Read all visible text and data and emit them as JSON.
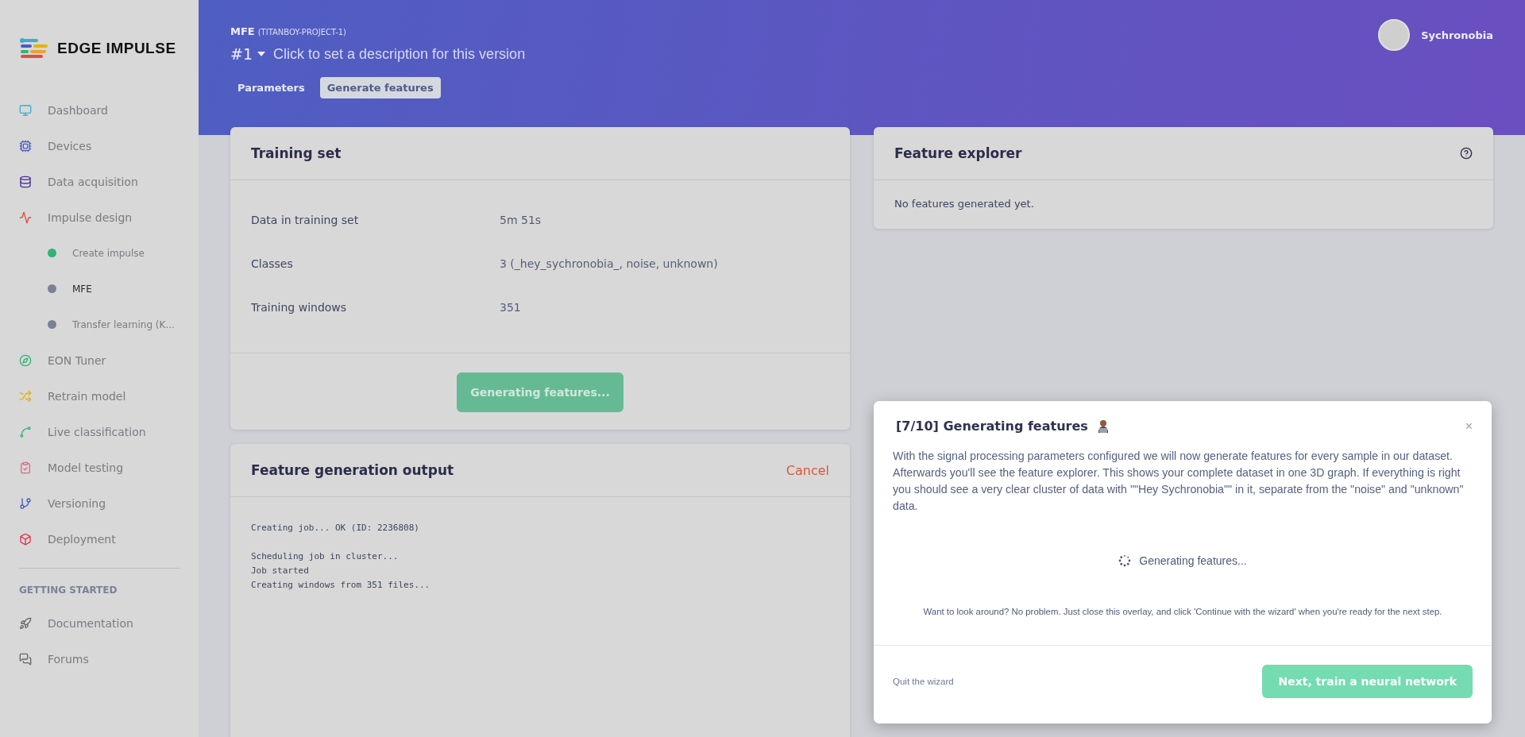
{
  "brand": {
    "name": "EDGE IMPULSE"
  },
  "nav": [
    {
      "label": "Dashboard",
      "selected": false
    },
    {
      "label": "Devices",
      "selected": false
    },
    {
      "label": "Data acquisition",
      "selected": false
    },
    {
      "label": "Impulse design",
      "selected": false,
      "children": [
        {
          "label": "Create impulse",
          "selected": false,
          "color": "#2db573"
        },
        {
          "label": "MFE",
          "selected": true,
          "color": "#7a8294"
        },
        {
          "label": "Transfer learning (K...",
          "selected": false,
          "color": "#7a8294"
        }
      ]
    },
    {
      "label": "EON Tuner",
      "selected": false
    },
    {
      "label": "Retrain model",
      "selected": false
    },
    {
      "label": "Live classification",
      "selected": false
    },
    {
      "label": "Model testing",
      "selected": false
    },
    {
      "label": "Versioning",
      "selected": false
    },
    {
      "label": "Deployment",
      "selected": false
    }
  ],
  "getting_started": {
    "heading": "GETTING STARTED",
    "items": [
      {
        "label": "Documentation"
      },
      {
        "label": "Forums"
      }
    ]
  },
  "header": {
    "block": "MFE",
    "project": "(TITANBOY-PROJECT-1)",
    "version": "#1",
    "description_placeholder": "Click to set a description for this version",
    "user": "Sychronobia",
    "tabs": [
      {
        "label": "Parameters",
        "selected": false
      },
      {
        "label": "Generate features",
        "selected": true
      }
    ]
  },
  "training_set": {
    "title": "Training set",
    "rows": [
      {
        "label": "Data in training set",
        "value": "5m 51s"
      },
      {
        "label": "Classes",
        "value": "3 (_hey_sychronobia_, noise, unknown)"
      },
      {
        "label": "Training windows",
        "value": "351"
      }
    ],
    "button": {
      "label": "Generating features...",
      "disabled": true
    }
  },
  "feature_explorer": {
    "title": "Feature explorer",
    "message": "No features generated yet."
  },
  "output": {
    "title": "Feature generation output",
    "cancel": "Cancel",
    "log_blocks": [
      [
        "Creating job... OK (ID: 2236808)"
      ],
      [
        "Scheduling job in cluster...",
        "Job started",
        "Creating windows from 351 files..."
      ]
    ]
  },
  "wizard": {
    "title": "[7/10] Generating features",
    "close": "×",
    "text": "With the signal processing parameters configured we will now generate features for every sample in our dataset. Afterwards you'll see the feature explorer. This shows your complete dataset in one 3D graph. If everything is right you should see a very clear cluster of data with \"\"Hey Sychronobia\"\" in it, separate from the \"noise\" and \"unknown\" data.",
    "status": "Generating features...",
    "note": "Want to look around? No problem. Just close this overlay, and click 'Continue with the wizard' when you're ready for the next step.",
    "quit": "Quit the wizard",
    "next": "Next, train a neural network"
  }
}
